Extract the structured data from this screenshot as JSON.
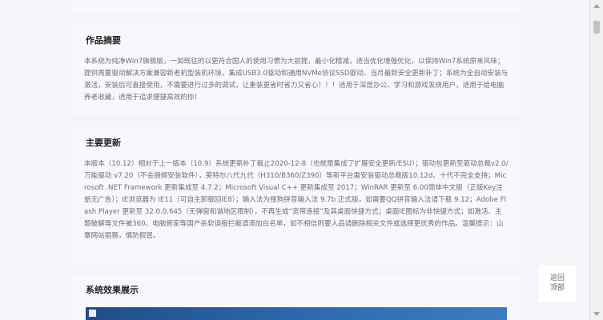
{
  "summary": {
    "title": "作品摘要",
    "body": "本系统为纯净Win7旗舰版，一如既往的以更符合国人的使用习惯为大前提，最小化精减，适当优化增强优化，以保持Win7系统原来风味；提供再要驱动解决方案兼容新老机型装机环境，集成USB3.0驱动和通用NVMe协议SSD驱动、当月最新安全更新补丁；系统为全自动安装与激活，安装后可直接使用，不需要进行过多的调试，让重装更省时省力又省心！！！适用于深度办公、学习和游戏发烧用户，适用于给电脑养老收藏，适用于追求便捷高效的你！"
  },
  "updates": {
    "title": "主要更新",
    "body": "本版本（10.12）相对于上一版本（10.9）系统更新补丁截止2020-12-8（也就是集成了扩展安全更新/ESU）；驱动包更新至驱动总裁v2.0/万能驱动 v7.20（不会捆绑安装软件），英特尔八代九代（H310/B360/Z390）等新平台需安装驱动总裁版10.12d、十代不完全支持；Microsoft .NET Framework 更新集成至 4.7.2；Microsoft Visual C++ 更新集成至 2017；WinRAR 更新至 6.00简体中文版（正版Key注册无广告）；IE浏览器为 IE11（可自主卸载回IE8）；输入法为搜狗拼音输入法 9.7b 正式版，如需要QQ拼音输入法请下载 9.12；Adobe Flash Player 更新至 32.0.0.645（无弹窗和谐地区限制），不再生成“宽带连接”及其桌面快捷方式；桌面IE图标为非快捷方式；如激活、主题破解等文件被360、电脑管家等国产杀软误报拦截请添加白名单，如不相信则要人品请删除相关文件或选择更优秀的作品。温馨提示：山寨网站猖獗，慎防假冒。"
  },
  "screens": {
    "title": "系统效果展示"
  },
  "back_to_top": {
    "line1": "返回",
    "line2": "顶部"
  },
  "colors": {
    "page_bg": "#f4f5f8",
    "card_bg": "#f7f8fb",
    "title_text": "#222222",
    "body_text": "#6d6f78"
  }
}
